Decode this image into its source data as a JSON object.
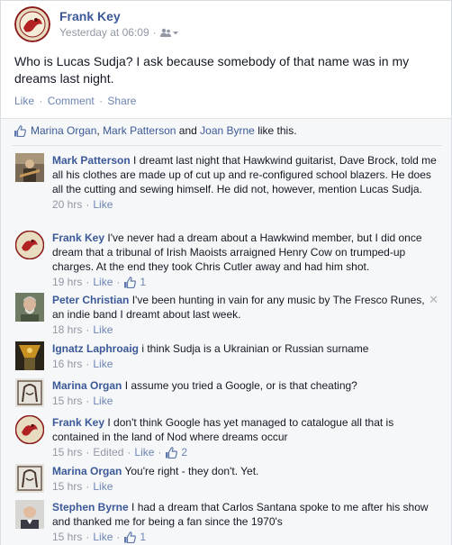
{
  "post": {
    "author": "Frank Key",
    "timestamp": "Yesterday at 06:09",
    "privacy_icon": "friends-icon",
    "text": "Who is Lucas Sudja? I ask because somebody of that name was in my dreams last night.",
    "actions": {
      "like": "Like",
      "comment": "Comment",
      "share": "Share",
      "separator": "·"
    }
  },
  "likes": {
    "names": [
      "Marina Organ",
      "Mark Patterson",
      "Joan Byrne"
    ],
    "comma": ",",
    "and": "and",
    "suffix": "like this."
  },
  "comments": [
    {
      "author": "Mark Patterson",
      "text": "I dreamt last night that Hawkwind guitarist, Dave Brock, told me all his clothes are made up of cut up and re-configured school blazers. He does all the cutting and sewing himself. He did not, however, mention Lucas Sudja.",
      "time": "20 hrs",
      "like_label": "Like",
      "avatar_color": "#7a6a55"
    },
    {
      "author": "Frank Key",
      "text": "I've never had a dream about a Hawkwind member, but I did once dream that a tribunal of Irish Maoists arraigned Henry Cow on trumped-up charges. At the end they took Chris Cutler away and had him shot.",
      "time": "19 hrs",
      "like_label": "Like",
      "like_count": "1"
    },
    {
      "author": "Peter Christian",
      "text": "I've been hunting in vain for any music by The Fresco Runes, an indie band I dreamt about last week.",
      "time": "18 hrs",
      "like_label": "Like",
      "close": "✕"
    },
    {
      "author": "Ignatz Laphroaig",
      "text": "i think Sudja is a Ukrainian or Russian surname",
      "time": "16 hrs",
      "like_label": "Like"
    },
    {
      "author": "Marina Organ",
      "text": "I assume you tried a Google, or is that cheating?",
      "time": "15 hrs",
      "like_label": "Like"
    },
    {
      "author": "Frank Key",
      "text": "I don't think Google has yet managed to catalogue all that is contained in the land of Nod where dreams occur",
      "time": "15 hrs",
      "edited": "Edited",
      "like_label": "Like",
      "like_count": "2"
    },
    {
      "author": "Marina Organ",
      "text": "You're right - they don't. Yet.",
      "time": "15 hrs",
      "like_label": "Like"
    },
    {
      "author": "Stephen Byrne",
      "text": "I had a dream that Carlos Santana spoke to me after his show and thanked me for being a fan since the 1970's",
      "time": "15 hrs",
      "like_label": "Like",
      "like_count": "1"
    }
  ],
  "colors": {
    "link": "#3b5998",
    "meta": "#9197a3",
    "action": "#6d84b4",
    "feedback_bg": "#f6f7f8"
  }
}
